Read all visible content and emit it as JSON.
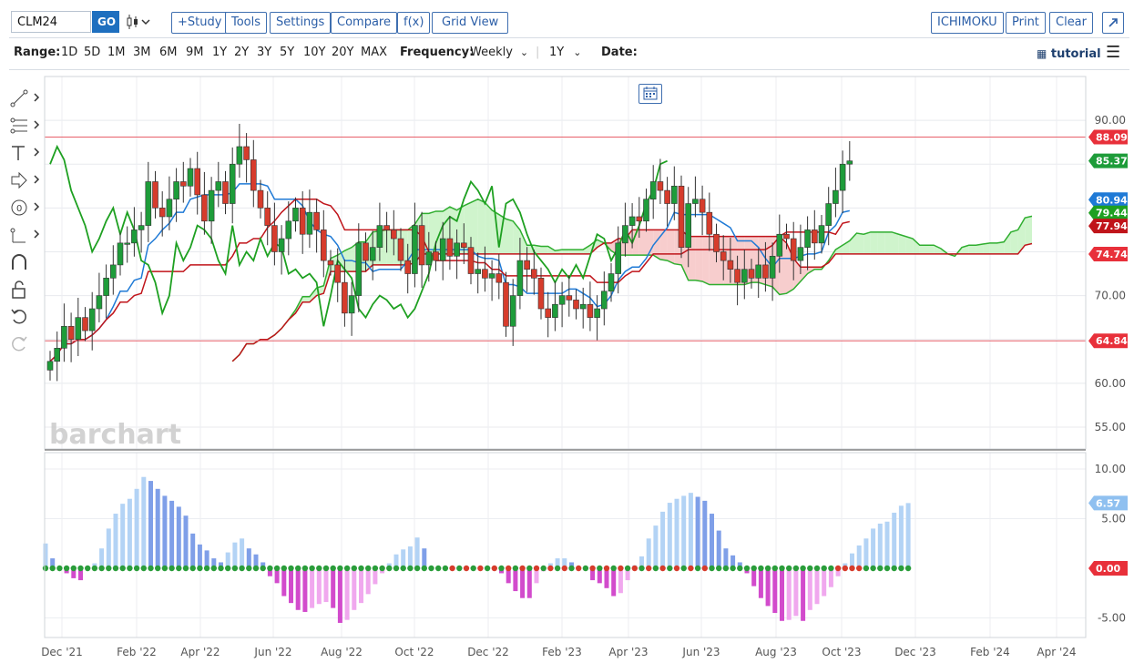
{
  "toolbar": {
    "symbol": "CLM24",
    "go_label": "GO",
    "chart_type_icon": "candlestick-icon",
    "buttons": [
      "+Study",
      "Tools",
      "Settings",
      "Compare",
      "f(x)",
      "Grid View"
    ],
    "right_buttons": [
      "ICHIMOKU",
      "Print",
      "Clear"
    ],
    "expand_icon": "expand-icon"
  },
  "range_bar": {
    "range_label": "Range:",
    "ranges": [
      "1D",
      "5D",
      "1M",
      "3M",
      "6M",
      "9M",
      "1Y",
      "2Y",
      "3Y",
      "5Y",
      "10Y",
      "20Y",
      "MAX"
    ],
    "frequency_label": "Frequency:",
    "frequency_value": "Weekly",
    "period_value": "1Y",
    "date_label": "Date:",
    "tutorial_label": "tutorial"
  },
  "sidebar_tools": [
    "line-tool-icon",
    "fib-tool-icon",
    "text-tool-icon",
    "arrow-tool-icon",
    "shape-tool-icon",
    "measure-tool-icon",
    "magnet-icon",
    "lock-icon",
    "undo-icon",
    "redo-icon"
  ],
  "watermark": "barchart",
  "colors": {
    "up": "#1e9c3a",
    "down": "#d63c2c",
    "tenkan": "#1f7ad6",
    "kijun": "#c0141a",
    "chikou": "#1ea021",
    "cloud_bull": "#c7f2c3",
    "cloud_bear": "#f6c4c4",
    "hist_strong_up": "#7f9fe8",
    "hist_weak_up": "#b3d3f5",
    "hist_strong_down": "#d24bcc",
    "hist_weak_down": "#f0a8ee"
  },
  "chart_data": {
    "type": "candlestick",
    "frequency": "Weekly",
    "price_axis": {
      "range": [
        52.5,
        95
      ],
      "ticks": [
        "90.00",
        "85.00",
        "80.00",
        "75.00",
        "70.00",
        "65.00",
        "60.00",
        "55.00"
      ]
    },
    "x_axis_labels": [
      "Dec '21",
      "Feb '22",
      "Apr '22",
      "Jun '22",
      "Aug '22",
      "Oct '22",
      "Dec '22",
      "Feb '23",
      "Apr '23",
      "Jun '23",
      "Aug '23",
      "Oct '23",
      "Dec '23",
      "Feb '24",
      "Apr '24"
    ],
    "horizontal_lines": [
      88.09,
      64.84
    ],
    "price_badges": [
      {
        "label": "88.09",
        "color": "#e8303a"
      },
      {
        "label": "85.37",
        "color": "#1e9c3a"
      },
      {
        "label": "80.94",
        "color": "#1f7ad6"
      },
      {
        "label": "79.44",
        "color": "#1ea021"
      },
      {
        "label": "77.94",
        "color": "#c0141a"
      },
      {
        "label": "74.74",
        "color": "#e8303a"
      },
      {
        "label": "64.84",
        "color": "#e8303a"
      }
    ],
    "closes": [
      62.5,
      64,
      66.5,
      65,
      67.5,
      66,
      68.5,
      70,
      72,
      73.5,
      76,
      76,
      77.5,
      78,
      83,
      80,
      79,
      81,
      83,
      82.5,
      84.5,
      81.5,
      78.5,
      82,
      83,
      80.5,
      85,
      87,
      85.5,
      82,
      80,
      78,
      75,
      76.5,
      78.5,
      80,
      77,
      79.5,
      77.5,
      74,
      73.5,
      71.5,
      68,
      70,
      76,
      74,
      75.5,
      78,
      77.5,
      76.5,
      74,
      72.5,
      78,
      73.5,
      75,
      74,
      76.5,
      74.5,
      76,
      75.5,
      72.5,
      73,
      72,
      72.5,
      71.5,
      66.5,
      70,
      74,
      73,
      72,
      68.5,
      67.5,
      69,
      70,
      69.5,
      68.5,
      69,
      67.5,
      68.5,
      70.5,
      72.5,
      76,
      78,
      79,
      78.5,
      81,
      83,
      82,
      80.5,
      82.5,
      75.5,
      80.5,
      81,
      79.5,
      77,
      75,
      74,
      73,
      71.5,
      73,
      72,
      73.5,
      72,
      74.5,
      77,
      76.5,
      74,
      75.5,
      77.5,
      76,
      78,
      80.5,
      82,
      85,
      85.37
    ],
    "indicator_panel": {
      "axis_ticks": [
        "10.00",
        "5.00",
        "-5.00"
      ],
      "badges": [
        {
          "label": "6.57",
          "color": "#8fc0f0"
        },
        {
          "label": "0.00",
          "color": "#e8303a"
        }
      ],
      "histogram": [
        2.5,
        1,
        0,
        -0.5,
        -1,
        -1.2,
        0,
        0.5,
        2,
        4,
        5.5,
        6.5,
        7,
        8,
        9.2,
        8.8,
        8,
        7.3,
        6.8,
        6.2,
        5.3,
        3.5,
        2.4,
        1.8,
        1,
        0.6,
        1.6,
        2.6,
        3,
        2,
        1.4,
        0.6,
        -0.8,
        -1.5,
        -2.8,
        -3.5,
        -4.2,
        -4.4,
        -4,
        -3.6,
        -3.4,
        -4,
        -5.5,
        -5.2,
        -4.2,
        -3.5,
        -2.6,
        -1.6,
        -0.5,
        0.5,
        1.4,
        1.9,
        2.2,
        3.1,
        2,
        0,
        0,
        0,
        0,
        0,
        0,
        0,
        0,
        0,
        0,
        -0.5,
        -1.5,
        -2.3,
        -3,
        -3,
        -1.5,
        -0.3,
        0.5,
        1,
        1,
        0.6,
        0.1,
        -0.2,
        -1.2,
        -1.5,
        -2,
        -2.8,
        -2.5,
        -1.2,
        0.3,
        1.2,
        3,
        4.3,
        5.7,
        6.6,
        7,
        7.3,
        7.6,
        7.2,
        6.8,
        5.5,
        3.8,
        2,
        1.3,
        0.6,
        -0.5,
        -1.8,
        -3,
        -3.8,
        -4.5,
        -5.3,
        -5.2,
        -4.8,
        -5.3,
        -4.2,
        -3.6,
        -2.8,
        -1.9,
        -0.8,
        0.5,
        1.5,
        2.3,
        3,
        4,
        4.5,
        4.7,
        5.6,
        6.3,
        6.57
      ]
    }
  }
}
